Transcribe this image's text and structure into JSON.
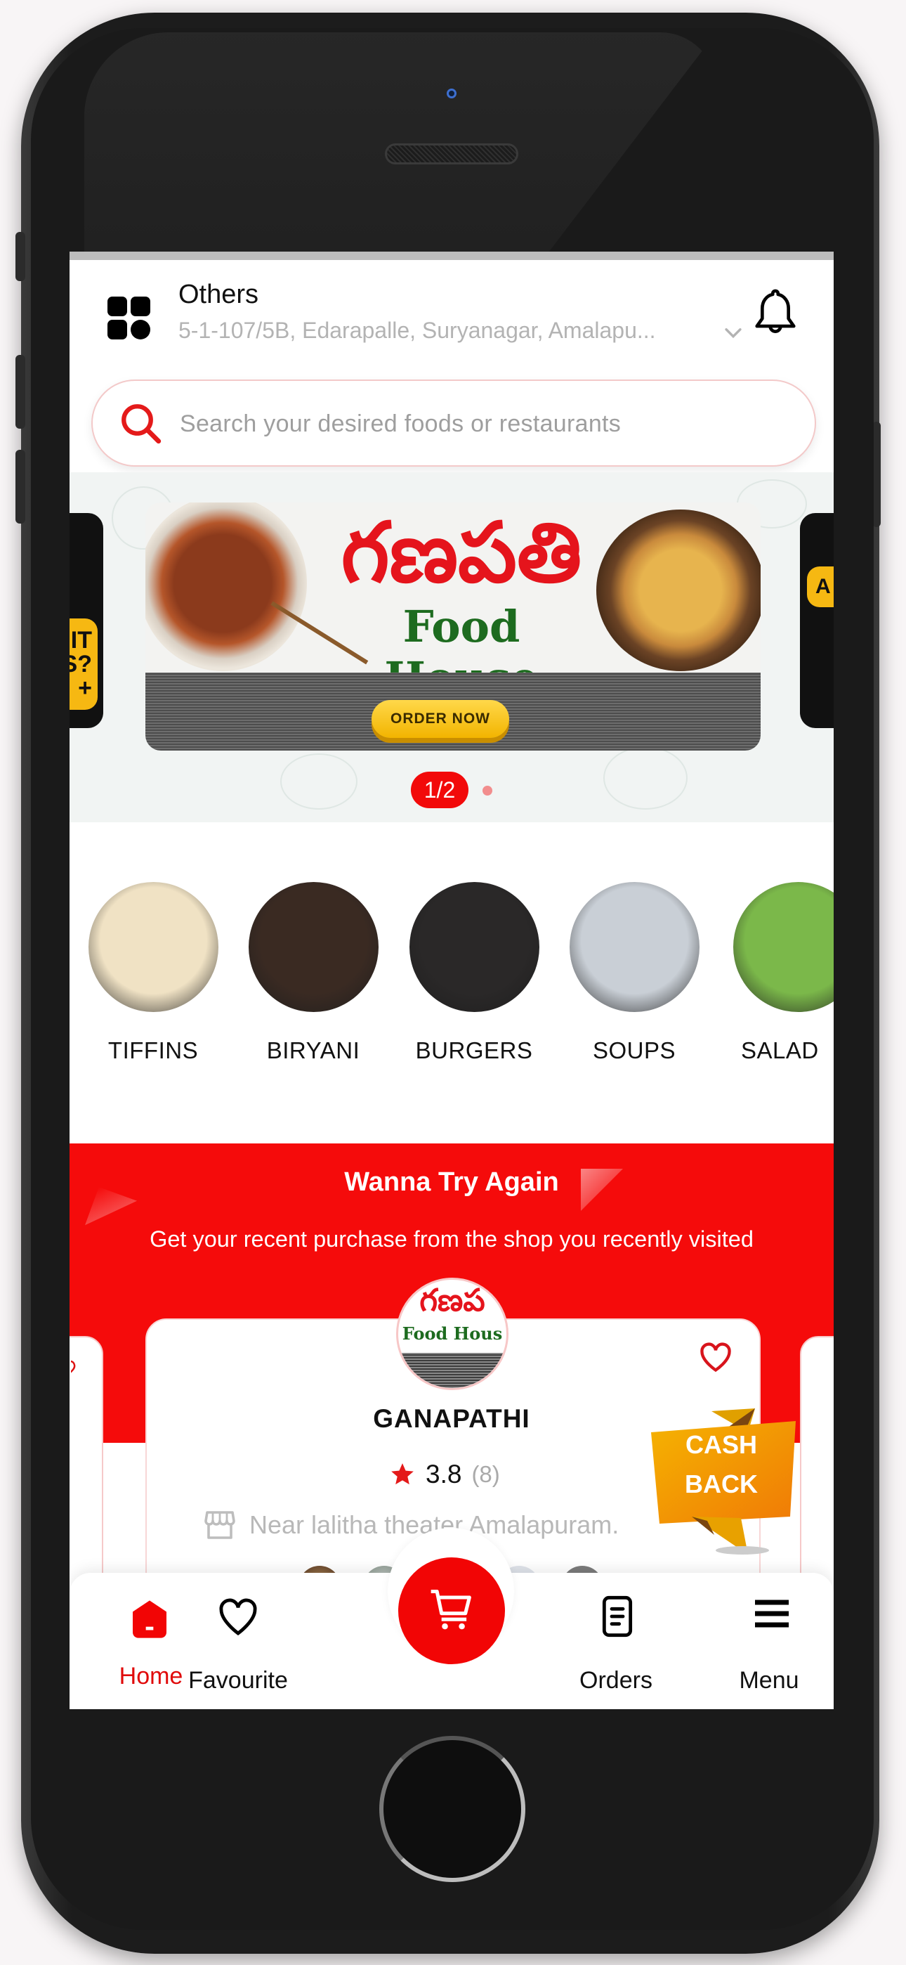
{
  "header": {
    "location_label": "Others",
    "address": "5-1-107/5B, Edarapalle, Suryanagar, Amalapu...",
    "menu_icon": "grid-icon",
    "dropdown_icon": "chevron-down-icon",
    "notification_icon": "bell-icon"
  },
  "search": {
    "placeholder": "Search your desired foods or restaurants",
    "icon": "search-icon"
  },
  "banner": {
    "restaurant_title_telugu": "గణపతి",
    "subtitle": "Food House",
    "cta_label": "ORDER NOW",
    "prev_peek_text": "W IT\nS?",
    "prev_peek_plus": "+",
    "next_peek_text": "A",
    "pager": "1/2"
  },
  "categories": [
    {
      "label": "TIFFINS",
      "color": "#f0e2c4"
    },
    {
      "label": "BIRYANI",
      "color": "#3a2a22"
    },
    {
      "label": "BURGERS",
      "color": "#2a2828"
    },
    {
      "label": "SOUPS",
      "color": "#c9cfd6"
    },
    {
      "label": "SALAD",
      "color": "#7bb84a"
    }
  ],
  "recent": {
    "title": "Wanna Try Again",
    "subtitle": "Get your recent purchase from the shop you recently visited",
    "card": {
      "logo_telugu": "గణప",
      "logo_sub": "Food Hous",
      "name": "GANAPATHI",
      "rating": "3.8",
      "rating_count": "(8)",
      "address": "Near lalitha theater,Amalapuram.",
      "badge_line1": "CASH",
      "badge_line2": "BACK",
      "favourite": false
    }
  },
  "bottom_nav": {
    "items": [
      {
        "label": "Home",
        "icon": "home-icon",
        "active": true
      },
      {
        "label": "Favourite",
        "icon": "heart-icon",
        "active": false
      },
      {
        "label": "Orders",
        "icon": "orders-icon",
        "active": false
      },
      {
        "label": "Menu",
        "icon": "hamburger-menu-icon",
        "active": false
      }
    ],
    "cart_icon": "cart-icon"
  },
  "colors": {
    "brand_red": "#f20505",
    "badge_orange": "#f39c12",
    "text_muted": "#b3b3b3"
  }
}
